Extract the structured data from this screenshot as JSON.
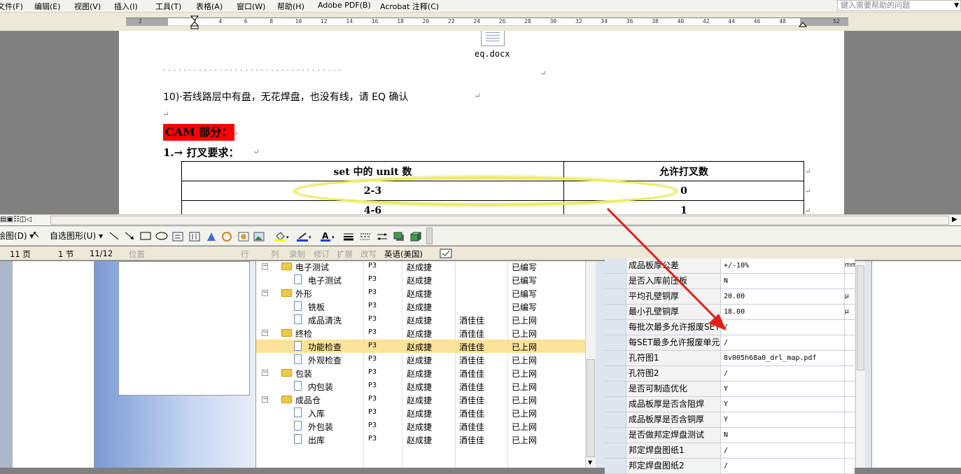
{
  "menu": {
    "items": [
      "文件(F)",
      "编辑(E)",
      "视图(V)",
      "插入(I)",
      "工具(T)",
      "表格(A)",
      "窗口(W)",
      "帮助(H)",
      "Adobe PDF(B)",
      "Acrobat 注释(C)"
    ],
    "help_placeholder": "键入需要帮助的问题"
  },
  "ruler": {
    "marks": [
      "2",
      "2",
      "4",
      "6",
      "8",
      "10",
      "12",
      "14",
      "16",
      "18",
      "20",
      "22",
      "24",
      "26",
      "28",
      "30",
      "32",
      "34",
      "36",
      "38",
      "40",
      "42",
      "44",
      "46",
      "48",
      "52"
    ]
  },
  "document": {
    "attachment_name": "eq.docx",
    "dots": "· · · · · · · · · · · · · · · · · · · · · · · · · · · · · · · · · · ·",
    "item10": "10)·若线路层中有盘，无花焊盘，也没有线，请 EQ 确认",
    "cam_heading": "CAM 部分：",
    "cross_heading": "1.→ 打叉要求：",
    "table": {
      "headers": [
        "set 中的 unit 数",
        "允许打叉数"
      ],
      "rows": [
        [
          "2-3",
          "0"
        ],
        [
          "4-6",
          "1"
        ]
      ]
    }
  },
  "drawbar": {
    "draw_label": "绘图(D) ▾",
    "autoshape_label": "自选图形(U) ▾"
  },
  "status": {
    "page": "11 页",
    "section": "1 节",
    "pages": "11/12",
    "position": "位置",
    "line": "行",
    "col": "列",
    "rec": "录制",
    "trk": "修订",
    "ext": "扩展",
    "ovr": "改写",
    "language": "英语(美国)"
  },
  "tree": {
    "rows": [
      {
        "name": "电子测试",
        "type": "folder",
        "level": 0,
        "c1": "P3",
        "c2": "赵成捷",
        "c3": "",
        "c4": "已编写"
      },
      {
        "name": "电子测试",
        "type": "file",
        "level": 1,
        "c1": "P3",
        "c2": "赵成捷",
        "c3": "",
        "c4": "已编写"
      },
      {
        "name": "外形",
        "type": "folder",
        "level": 0,
        "c1": "P3",
        "c2": "赵成捷",
        "c3": "",
        "c4": "已编写"
      },
      {
        "name": "铣板",
        "type": "file",
        "level": 1,
        "c1": "P3",
        "c2": "赵成捷",
        "c3": "",
        "c4": "已编写"
      },
      {
        "name": "成品清洗",
        "type": "file",
        "level": 1,
        "c1": "P3",
        "c2": "赵成捷",
        "c3": "酒佳佳",
        "c4": "已上网"
      },
      {
        "name": "终检",
        "type": "folder",
        "level": 0,
        "c1": "P3",
        "c2": "赵成捷",
        "c3": "酒佳佳",
        "c4": "已上网"
      },
      {
        "name": "功能检查",
        "type": "file",
        "level": 1,
        "c1": "P3",
        "c2": "赵成捷",
        "c3": "酒佳佳",
        "c4": "已上网",
        "selected": true
      },
      {
        "name": "外观检查",
        "type": "file",
        "level": 1,
        "c1": "P3",
        "c2": "赵成捷",
        "c3": "酒佳佳",
        "c4": "已上网"
      },
      {
        "name": "包装",
        "type": "folder",
        "level": 0,
        "c1": "P3",
        "c2": "赵成捷",
        "c3": "酒佳佳",
        "c4": "已上网"
      },
      {
        "name": "内包装",
        "type": "file",
        "level": 1,
        "c1": "P3",
        "c2": "赵成捷",
        "c3": "酒佳佳",
        "c4": "已上网"
      },
      {
        "name": "成品仓",
        "type": "folder",
        "level": 0,
        "c1": "P3",
        "c2": "赵成捷",
        "c3": "酒佳佳",
        "c4": "已上网"
      },
      {
        "name": "入库",
        "type": "file",
        "level": 1,
        "c1": "P3",
        "c2": "赵成捷",
        "c3": "酒佳佳",
        "c4": "已上网"
      },
      {
        "name": "外包装",
        "type": "file",
        "level": 1,
        "c1": "P3",
        "c2": "赵成捷",
        "c3": "酒佳佳",
        "c4": "已上网"
      },
      {
        "name": "出库",
        "type": "file",
        "level": 1,
        "c1": "P3",
        "c2": "赵成捷",
        "c3": "酒佳佳",
        "c4": "已上网"
      }
    ]
  },
  "properties": {
    "rows": [
      {
        "label": "成品板厚公差",
        "value": "+/-10%",
        "unit": "mm"
      },
      {
        "label": "是否入库前压板",
        "value": "N",
        "unit": ""
      },
      {
        "label": "平均孔壁铜厚",
        "value": "20.00",
        "unit": "μ"
      },
      {
        "label": "最小孔壁铜厚",
        "value": "18.00",
        "unit": "μ"
      },
      {
        "label": "每批次最多允许报废SET",
        "value": "/",
        "unit": ""
      },
      {
        "label": "每SET最多允许报废单元",
        "value": "/",
        "unit": ""
      },
      {
        "label": "孔符图1",
        "value": "8v005h68a0_drl_map.pdf",
        "unit": ""
      },
      {
        "label": "孔符图2",
        "value": "/",
        "unit": ""
      },
      {
        "label": "是否可制造优化",
        "value": "Y",
        "unit": ""
      },
      {
        "label": "成品板厚是否含阻焊",
        "value": "Y",
        "unit": ""
      },
      {
        "label": "成品板厚是否含铜厚",
        "value": "Y",
        "unit": ""
      },
      {
        "label": "是否做邦定焊盘测试",
        "value": "N",
        "unit": ""
      },
      {
        "label": "邦定焊盘图纸1",
        "value": "/",
        "unit": ""
      },
      {
        "label": "邦定焊盘图纸2",
        "value": "/",
        "unit": ""
      }
    ]
  },
  "colors": {
    "highlight_red": "#ff0000",
    "annotation_yellow": "#ecec60",
    "arrow_red": "#e0201a",
    "selection": "#fbe39a"
  }
}
